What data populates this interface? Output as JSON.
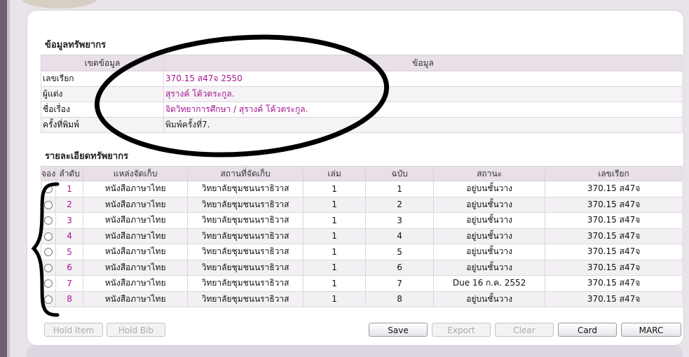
{
  "resource_info": {
    "title": "ข้อมูลทรัพยากร",
    "col_field": "เขตข้อมูล",
    "col_value": "ข้อมูล",
    "rows": [
      {
        "label": "เลขเรียก",
        "value": "370.15 ส47จ 2550",
        "linked": true
      },
      {
        "label": "ผู้แต่ง",
        "value": "สุรางค์ โค้วตระกูล.",
        "linked": true
      },
      {
        "label": "ชื่อเรื่อง",
        "value": "จิตวิทยาการศึกษา / สุรางค์ โค้วตระกูล.",
        "linked": true
      },
      {
        "label": "ครั้งที่พิมพ์",
        "value": "พิมพ์ครั้งที่7.",
        "linked": false
      }
    ]
  },
  "items_detail": {
    "title": "รายละเอียดทรัพยากร",
    "headers": [
      "จอง",
      "ลำดับ",
      "แหล่งจัดเก็บ",
      "สถานที่จัดเก็บ",
      "เล่ม",
      "ฉบับ",
      "สถานะ",
      "เลขเรียก"
    ],
    "rows": [
      {
        "seq": "1",
        "collection": "หนังสือภาษาไทย",
        "location": "วิทยาลัยชุมชนนราธิวาส",
        "volume": "1",
        "copy": "1",
        "status": "อยู่บนชั้นวาง",
        "call_no": "370.15 ส47จ"
      },
      {
        "seq": "2",
        "collection": "หนังสือภาษาไทย",
        "location": "วิทยาลัยชุมชนนราธิวาส",
        "volume": "1",
        "copy": "2",
        "status": "อยู่บนชั้นวาง",
        "call_no": "370.15 ส47จ"
      },
      {
        "seq": "3",
        "collection": "หนังสือภาษาไทย",
        "location": "วิทยาลัยชุมชนนราธิวาส",
        "volume": "1",
        "copy": "3",
        "status": "อยู่บนชั้นวาง",
        "call_no": "370.15 ส47จ"
      },
      {
        "seq": "4",
        "collection": "หนังสือภาษาไทย",
        "location": "วิทยาลัยชุมชนนราธิวาส",
        "volume": "1",
        "copy": "4",
        "status": "อยู่บนชั้นวาง",
        "call_no": "370.15 ส47จ"
      },
      {
        "seq": "5",
        "collection": "หนังสือภาษาไทย",
        "location": "วิทยาลัยชุมชนนราธิวาส",
        "volume": "1",
        "copy": "5",
        "status": "อยู่บนชั้นวาง",
        "call_no": "370.15 ส47จ"
      },
      {
        "seq": "6",
        "collection": "หนังสือภาษาไทย",
        "location": "วิทยาลัยชุมชนนราธิวาส",
        "volume": "1",
        "copy": "6",
        "status": "อยู่บนชั้นวาง",
        "call_no": "370.15 ส47จ"
      },
      {
        "seq": "7",
        "collection": "หนังสือภาษาไทย",
        "location": "วิทยาลัยชุมชนนราธิวาส",
        "volume": "1",
        "copy": "7",
        "status": "Due 16 ก.ค. 2552",
        "call_no": "370.15 ส47จ"
      },
      {
        "seq": "8",
        "collection": "หนังสือภาษาไทย",
        "location": "วิทยาลัยชุมชนนราธิวาส",
        "volume": "1",
        "copy": "8",
        "status": "อยู่บนชั้นวาง",
        "call_no": "370.15 ส47จ"
      }
    ]
  },
  "buttons": {
    "hold_item": "Hold Item",
    "hold_bib": "Hold Bib",
    "save": "Save",
    "export": "Export",
    "clear": "Clear",
    "card": "Card",
    "marc": "MARC"
  },
  "colors": {
    "link": "#a4158f",
    "header_bg": "#e8dfe9",
    "frame": "#6d5f73"
  }
}
